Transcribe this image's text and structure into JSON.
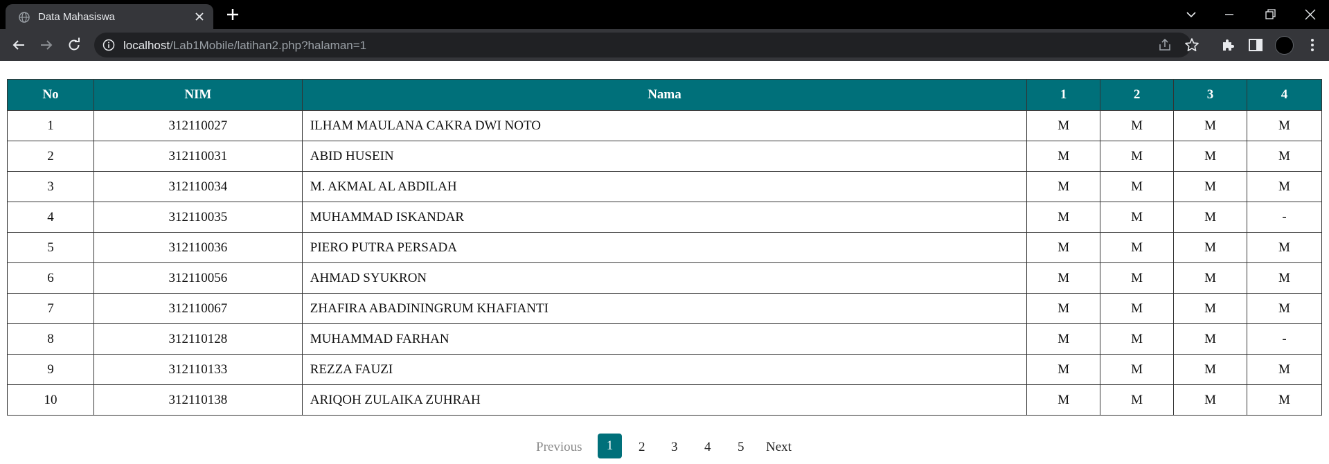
{
  "browser": {
    "tab_title": "Data Mahasiswa",
    "url_host": "localhost",
    "url_path": "/Lab1Mobile/latihan2.php?halaman=1"
  },
  "table": {
    "headers": [
      "No",
      "NIM",
      "Nama",
      "1",
      "2",
      "3",
      "4"
    ],
    "rows": [
      [
        "1",
        "312110027",
        "ILHAM MAULANA CAKRA DWI NOTO",
        "M",
        "M",
        "M",
        "M"
      ],
      [
        "2",
        "312110031",
        "ABID HUSEIN",
        "M",
        "M",
        "M",
        "M"
      ],
      [
        "3",
        "312110034",
        "M. AKMAL AL ABDILAH",
        "M",
        "M",
        "M",
        "M"
      ],
      [
        "4",
        "312110035",
        "MUHAMMAD ISKANDAR",
        "M",
        "M",
        "M",
        "-"
      ],
      [
        "5",
        "312110036",
        "PIERO PUTRA PERSADA",
        "M",
        "M",
        "M",
        "M"
      ],
      [
        "6",
        "312110056",
        "AHMAD SYUKRON",
        "M",
        "M",
        "M",
        "M"
      ],
      [
        "7",
        "312110067",
        "ZHAFIRA ABADININGRUM KHAFIANTI",
        "M",
        "M",
        "M",
        "M"
      ],
      [
        "8",
        "312110128",
        "MUHAMMAD FARHAN",
        "M",
        "M",
        "M",
        "-"
      ],
      [
        "9",
        "312110133",
        "REZZA FAUZI",
        "M",
        "M",
        "M",
        "M"
      ],
      [
        "10",
        "312110138",
        "ARIQOH ZULAIKA ZUHRAH",
        "M",
        "M",
        "M",
        "M"
      ]
    ]
  },
  "pagination": {
    "previous": "Previous",
    "pages": [
      "1",
      "2",
      "3",
      "4",
      "5"
    ],
    "current": "1",
    "next": "Next"
  },
  "colors": {
    "header_bg": "#00707a",
    "active_page_bg": "#00707a"
  }
}
